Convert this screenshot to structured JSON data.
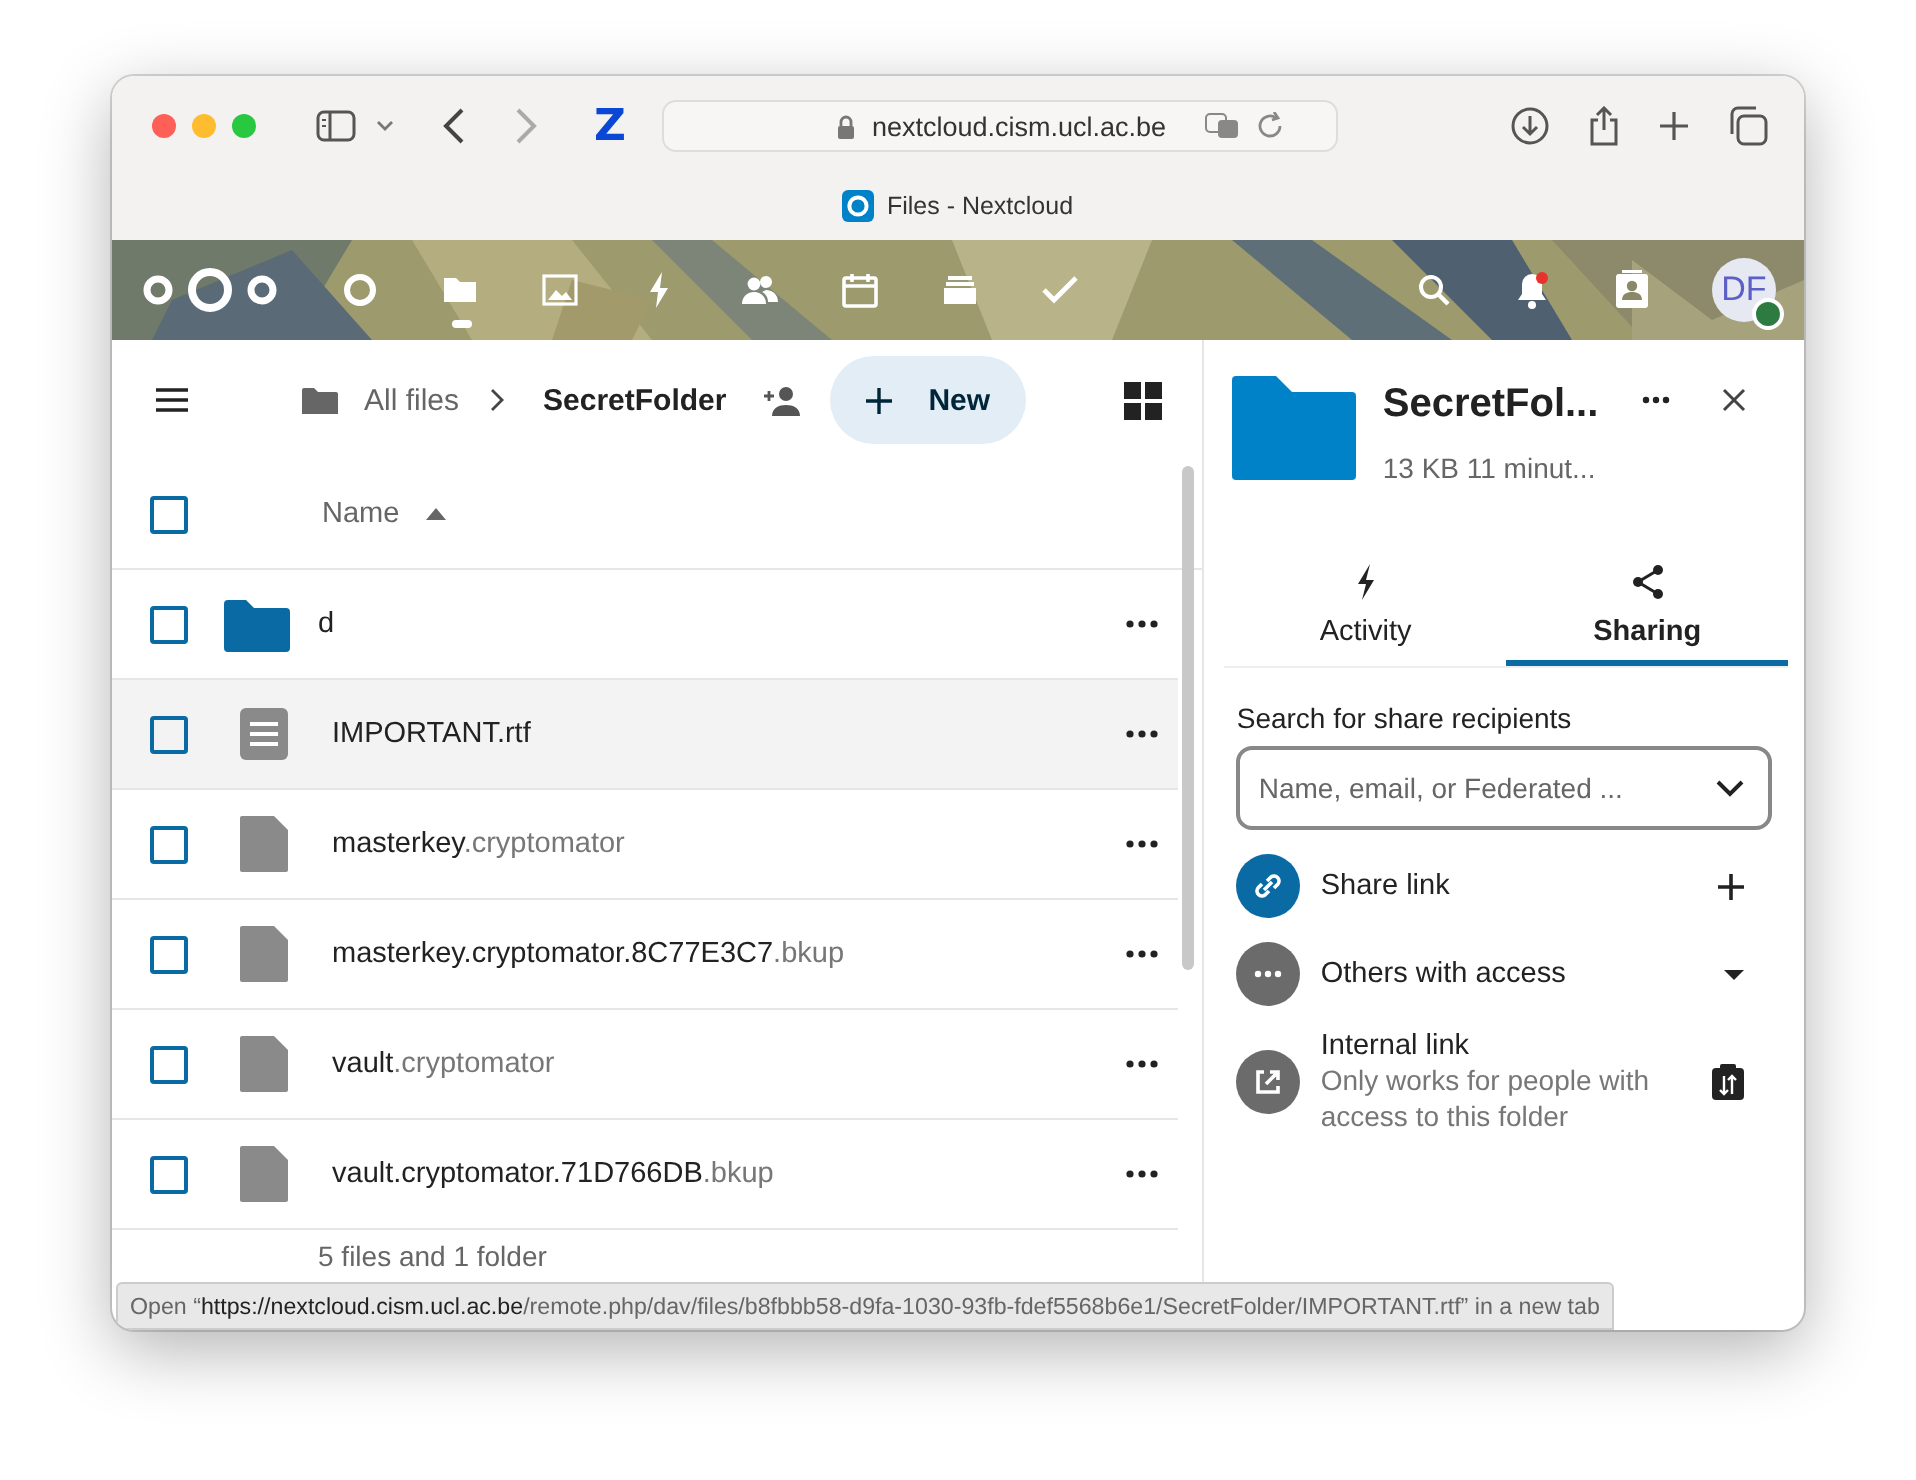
{
  "browser": {
    "extension_logo": "Z",
    "url": "nextcloud.cism.ucl.ac.be",
    "tab_title": "Files - Nextcloud"
  },
  "header": {
    "apps": [
      {
        "kind": "dashboard",
        "selected": false
      },
      {
        "kind": "files",
        "selected": true
      },
      {
        "kind": "photos",
        "selected": false
      },
      {
        "kind": "activity",
        "selected": false
      },
      {
        "kind": "contacts",
        "selected": false
      },
      {
        "kind": "calendar",
        "selected": false
      },
      {
        "kind": "deck",
        "selected": false
      },
      {
        "kind": "tasks",
        "selected": false
      }
    ],
    "has_notification": true,
    "avatar": "DF",
    "online": true
  },
  "breadcrumbs": {
    "root": "All files",
    "current": "SecretFolder",
    "new_button": "New"
  },
  "table": {
    "select_all_checked": false,
    "column": "Name",
    "files": [
      {
        "kind": "folder",
        "name": "d",
        "checked": false,
        "hovered": false
      },
      {
        "kind": "document",
        "name": "IMPORTANT.rtf",
        "checked": false,
        "hovered": true
      },
      {
        "kind": "file",
        "name": "masterkey",
        "ext": ".cryptomator",
        "checked": false,
        "hovered": false
      },
      {
        "kind": "file",
        "name": "masterkey.cryptomator.8C77E3C7",
        "ext": ".bkup",
        "checked": false,
        "hovered": false
      },
      {
        "kind": "file",
        "name": "vault",
        "ext": ".cryptomator",
        "checked": false,
        "hovered": false
      },
      {
        "kind": "file",
        "name": "vault.cryptomator.71D766DB",
        "ext": ".bkup",
        "checked": false,
        "hovered": false
      }
    ],
    "summary": "5 files and 1 folder"
  },
  "sidebar": {
    "title": "SecretFol...",
    "subtitle": "13 KB 11 minut...",
    "tabs": [
      {
        "kind": "activity",
        "label": "Activity",
        "selected": false
      },
      {
        "kind": "sharing",
        "label": "Sharing",
        "selected": true
      }
    ],
    "search_label": "Search for share recipients",
    "search_placeholder": "Name, email, or Federated ...",
    "entries": [
      {
        "kind": "link",
        "title": "Share link"
      },
      {
        "kind": "others",
        "title": "Others with access"
      },
      {
        "kind": "internal",
        "title": "Internal link",
        "subtitle": "Only works for people with access to this folder"
      }
    ]
  },
  "status_bar": "Open “**https://nextcloud.cism.ucl.ac.be**/remote.php/dav/files/b8fbbb58-d9fa-1030-93fb-fdef5568b6e1/SecretFolder/IMPORTANT.rtf” in a new tab"
}
